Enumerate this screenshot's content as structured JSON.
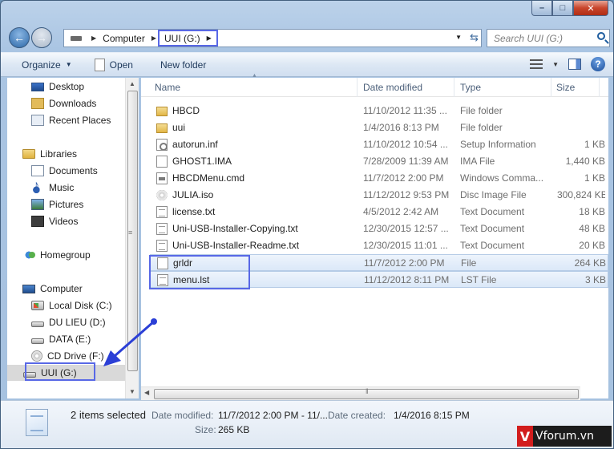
{
  "address": {
    "crumbs": [
      "Computer",
      "UUI (G:)"
    ],
    "search_placeholder": "Search UUI (G:)"
  },
  "toolbar": {
    "organize": "Organize",
    "open": "Open",
    "new_folder": "New folder"
  },
  "nav": {
    "favorites": [
      "Desktop",
      "Downloads",
      "Recent Places"
    ],
    "libraries": "Libraries",
    "library_items": [
      "Documents",
      "Music",
      "Pictures",
      "Videos"
    ],
    "homegroup": "Homegroup",
    "computer": "Computer",
    "drives": [
      "Local Disk (C:)",
      "DU LIEU (D:)",
      "DATA (E:)",
      "CD Drive (F:)",
      "UUI (G:)"
    ]
  },
  "columns": {
    "name": "Name",
    "date": "Date modified",
    "type": "Type",
    "size": "Size"
  },
  "files": [
    {
      "name": "HBCD",
      "date": "11/10/2012 11:35 ...",
      "type": "File folder",
      "size": "",
      "icon": "folder"
    },
    {
      "name": "uui",
      "date": "1/4/2016 8:13 PM",
      "type": "File folder",
      "size": "",
      "icon": "folder"
    },
    {
      "name": "autorun.inf",
      "date": "11/10/2012 10:54 ...",
      "type": "Setup Information",
      "size": "1 KB",
      "icon": "setup"
    },
    {
      "name": "GHOST1.IMA",
      "date": "7/28/2009 11:39 AM",
      "type": "IMA File",
      "size": "1,440 KB",
      "icon": "doc"
    },
    {
      "name": "HBCDMenu.cmd",
      "date": "11/7/2012 2:00 PM",
      "type": "Windows Comma...",
      "size": "1 KB",
      "icon": "cmd"
    },
    {
      "name": "JULIA.iso",
      "date": "11/12/2012 9:53 PM",
      "type": "Disc Image File",
      "size": "300,824 KB",
      "icon": "iso"
    },
    {
      "name": "license.txt",
      "date": "4/5/2012 2:42 AM",
      "type": "Text Document",
      "size": "18 KB",
      "icon": "text"
    },
    {
      "name": "Uni-USB-Installer-Copying.txt",
      "date": "12/30/2015 12:57 ...",
      "type": "Text Document",
      "size": "48 KB",
      "icon": "text"
    },
    {
      "name": "Uni-USB-Installer-Readme.txt",
      "date": "12/30/2015 11:01 ...",
      "type": "Text Document",
      "size": "20 KB",
      "icon": "text"
    },
    {
      "name": "grldr",
      "date": "11/7/2012 2:00 PM",
      "type": "File",
      "size": "264 KB",
      "icon": "doc",
      "selected": true
    },
    {
      "name": "menu.lst",
      "date": "11/12/2012 8:11 PM",
      "type": "LST File",
      "size": "3 KB",
      "icon": "text",
      "selected": true
    }
  ],
  "details": {
    "count": "2 items selected",
    "modified_label": "Date modified:",
    "modified_value": "11/7/2012 2:00 PM - 11/...",
    "created_label": "Date created:",
    "created_value": "1/4/2016 8:15 PM",
    "size_label": "Size:",
    "size_value": "265 KB"
  },
  "watermark": {
    "mark": "V",
    "text": "Vforum.vn"
  }
}
